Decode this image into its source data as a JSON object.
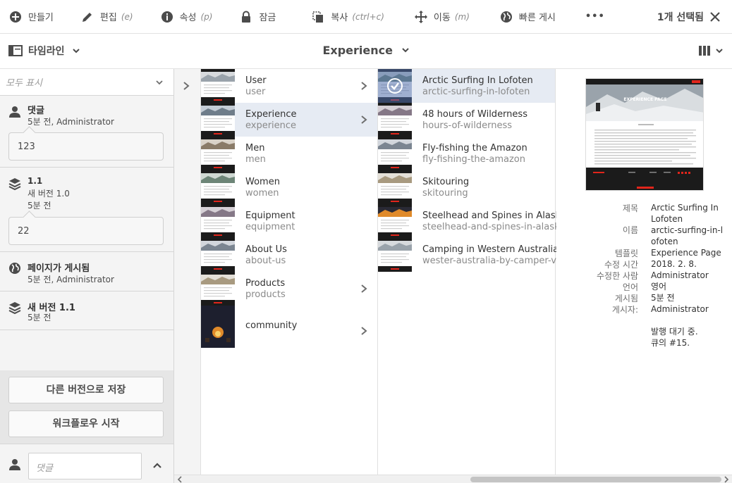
{
  "actionbar": {
    "create": "만들기",
    "edit": "편집",
    "edit_shortcut": "(e)",
    "properties": "속성",
    "properties_shortcut": "(p)",
    "lock": "잠금",
    "copy": "복사",
    "copy_shortcut": "(ctrl+c)",
    "move": "이동",
    "move_shortcut": "(m)",
    "quick_publish": "빠른 게시",
    "more": "•••",
    "selected_count": "1개 선택됨"
  },
  "header": {
    "rail_label": "타임라인",
    "page_title": "Experience"
  },
  "rail": {
    "filter": "모두 표시",
    "entries": [
      {
        "title": "댓글",
        "sub": "5분 전, Administrator",
        "bubble": "123",
        "icon": "user-icon"
      },
      {
        "title": "1.1",
        "sub1": "새 버전 1.0",
        "sub2": "5분 전",
        "bubble": "22",
        "icon": "layers-icon"
      },
      {
        "title": "페이지가 게시됨",
        "sub": "5분 전, Administrator",
        "icon": "globe-icon"
      },
      {
        "title": "새 버전 1.1",
        "sub": "5분 전",
        "icon": "layers-icon"
      }
    ],
    "save_version": "다른 버전으로 저장",
    "start_workflow": "워크플로우 시작",
    "comment_placeholder": "댓글"
  },
  "column1": [
    {
      "title": "User",
      "name": "user",
      "has_children": true
    },
    {
      "title": "Experience",
      "name": "experience",
      "has_children": true,
      "selected": true
    },
    {
      "title": "Men",
      "name": "men",
      "has_children": false
    },
    {
      "title": "Women",
      "name": "women",
      "has_children": false
    },
    {
      "title": "Equipment",
      "name": "equipment",
      "has_children": false
    },
    {
      "title": "About Us",
      "name": "about-us",
      "has_children": false
    },
    {
      "title": "Products",
      "name": "products",
      "has_children": true
    },
    {
      "title": "community",
      "name": "",
      "has_children": true
    }
  ],
  "column2": [
    {
      "title": "Arctic Surfing In Lofoten",
      "name": "arctic-surfing-in-lofoten",
      "selected": true
    },
    {
      "title": "48 hours of Wilderness",
      "name": "hours-of-wilderness"
    },
    {
      "title": "Fly-fishing the Amazon",
      "name": "fly-fishing-the-amazon"
    },
    {
      "title": "Skitouring",
      "name": "skitouring"
    },
    {
      "title": "Steelhead and Spines in Alaska",
      "name": "steelhead-and-spines-in-alaska"
    },
    {
      "title": "Camping in Western Australia",
      "name": "wester-australia-by-camper-van"
    }
  ],
  "meta": {
    "preview_heading": "EXPERIENCE PAGE",
    "labels": {
      "title": "제목",
      "name": "이름",
      "template": "템플릿",
      "modified": "수정 시간",
      "modified_by": "수정한 사람",
      "language": "언어",
      "published": "게시됨",
      "published_by": "게시자:"
    },
    "values": {
      "title": "Arctic Surfing In Lofoten",
      "name": "arctic-surfing-in-lofoten",
      "template": "Experience Page",
      "modified": "2018. 2. 8.",
      "modified_by": "Administrator",
      "language": "영어",
      "published": "5분 전",
      "published_by": "Administrator",
      "queue_status": "발행 대기 중. 큐의 #15."
    }
  },
  "colors": {
    "selected_row": "#e6ebf3",
    "check": "#ffffff",
    "red": "#e1251b"
  }
}
